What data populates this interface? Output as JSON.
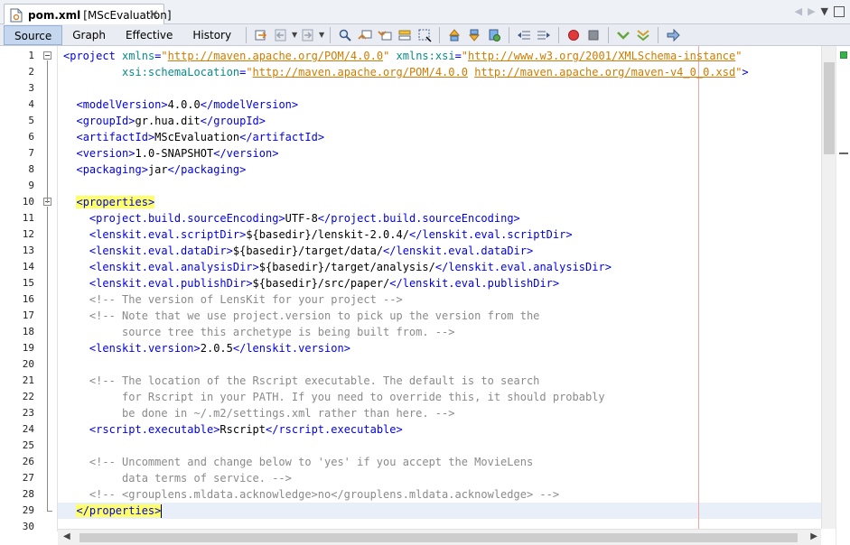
{
  "tab": {
    "file_name": "pom.xml",
    "project": "[MScEvaluation]",
    "close": "×",
    "nav_left": "◀",
    "nav_right": "▶",
    "nav_down": "▼"
  },
  "view_tabs": [
    "Source",
    "Graph",
    "Effective",
    "History"
  ],
  "selected_view": "Source",
  "toolbar_icons": [
    "last-edit-icon",
    "back-icon",
    "forward-icon",
    "find-icon",
    "find-previous-icon",
    "find-next-icon",
    "toggle-highlight-icon",
    "toggle-rect-select-icon",
    "previous-bookmark-icon",
    "next-bookmark-icon",
    "toggle-bookmark-icon",
    "shift-left-icon",
    "shift-right-icon",
    "start-macro-icon",
    "stop-macro-icon",
    "check-xml-icon",
    "validate-xml-icon",
    "xsl-transform-icon"
  ],
  "colors": {
    "tag": "#0000e6",
    "attr": "#098a8a",
    "value": "#ce7b00",
    "comment": "#8a8a8a",
    "highlight": "#ffff66"
  },
  "editor": {
    "current_line": 29,
    "lines": [
      {
        "n": "1",
        "text": "<project xmlns=\"http://maven.apache.org/POM/4.0.0\" xmlns:xsi=\"http://www.w3.org/2001/XMLSchema-instance\""
      },
      {
        "n": "2",
        "text": "         xsi:schemaLocation=\"http://maven.apache.org/POM/4.0.0 http://maven.apache.org/maven-v4_0_0.xsd\">"
      },
      {
        "n": "3",
        "text": ""
      },
      {
        "n": "4",
        "text": "  <modelVersion>4.0.0</modelVersion>"
      },
      {
        "n": "5",
        "text": "  <groupId>gr.hua.dit</groupId>"
      },
      {
        "n": "6",
        "text": "  <artifactId>MScEvaluation</artifactId>"
      },
      {
        "n": "7",
        "text": "  <version>1.0-SNAPSHOT</version>"
      },
      {
        "n": "8",
        "text": "  <packaging>jar</packaging>"
      },
      {
        "n": "9",
        "text": ""
      },
      {
        "n": "10",
        "text": "  <properties>"
      },
      {
        "n": "11",
        "text": "    <project.build.sourceEncoding>UTF-8</project.build.sourceEncoding>"
      },
      {
        "n": "12",
        "text": "    <lenskit.eval.scriptDir>${basedir}/lenskit-2.0.4/</lenskit.eval.scriptDir>"
      },
      {
        "n": "13",
        "text": "    <lenskit.eval.dataDir>${basedir}/target/data/</lenskit.eval.dataDir>"
      },
      {
        "n": "14",
        "text": "    <lenskit.eval.analysisDir>${basedir}/target/analysis/</lenskit.eval.analysisDir>"
      },
      {
        "n": "15",
        "text": "    <lenskit.eval.publishDir>${basedir}/src/paper/</lenskit.eval.publishDir>"
      },
      {
        "n": "16",
        "text": "    <!-- The version of LensKit for your project -->"
      },
      {
        "n": "17",
        "text": "    <!-- Note that we use project.version to pick up the version from the"
      },
      {
        "n": "18",
        "text": "         source tree this archetype is being built from. -->"
      },
      {
        "n": "19",
        "text": "    <lenskit.version>2.0.5</lenskit.version>"
      },
      {
        "n": "20",
        "text": ""
      },
      {
        "n": "21",
        "text": "    <!-- The location of the Rscript executable. The default is to search"
      },
      {
        "n": "22",
        "text": "         for Rscript in your PATH. If you need to override this, it should probably"
      },
      {
        "n": "23",
        "text": "         be done in ~/.m2/settings.xml rather than here. -->"
      },
      {
        "n": "24",
        "text": "    <rscript.executable>Rscript</rscript.executable>"
      },
      {
        "n": "25",
        "text": ""
      },
      {
        "n": "26",
        "text": "    <!-- Uncomment and change below to 'yes' if you accept the MovieLens"
      },
      {
        "n": "27",
        "text": "         data terms of service. -->"
      },
      {
        "n": "28",
        "text": "    <!-- <grouplens.mldata.acknowledge>no</grouplens.mldata.acknowledge> -->"
      },
      {
        "n": "29",
        "text": "  </properties>"
      },
      {
        "n": "30",
        "text": ""
      }
    ]
  }
}
